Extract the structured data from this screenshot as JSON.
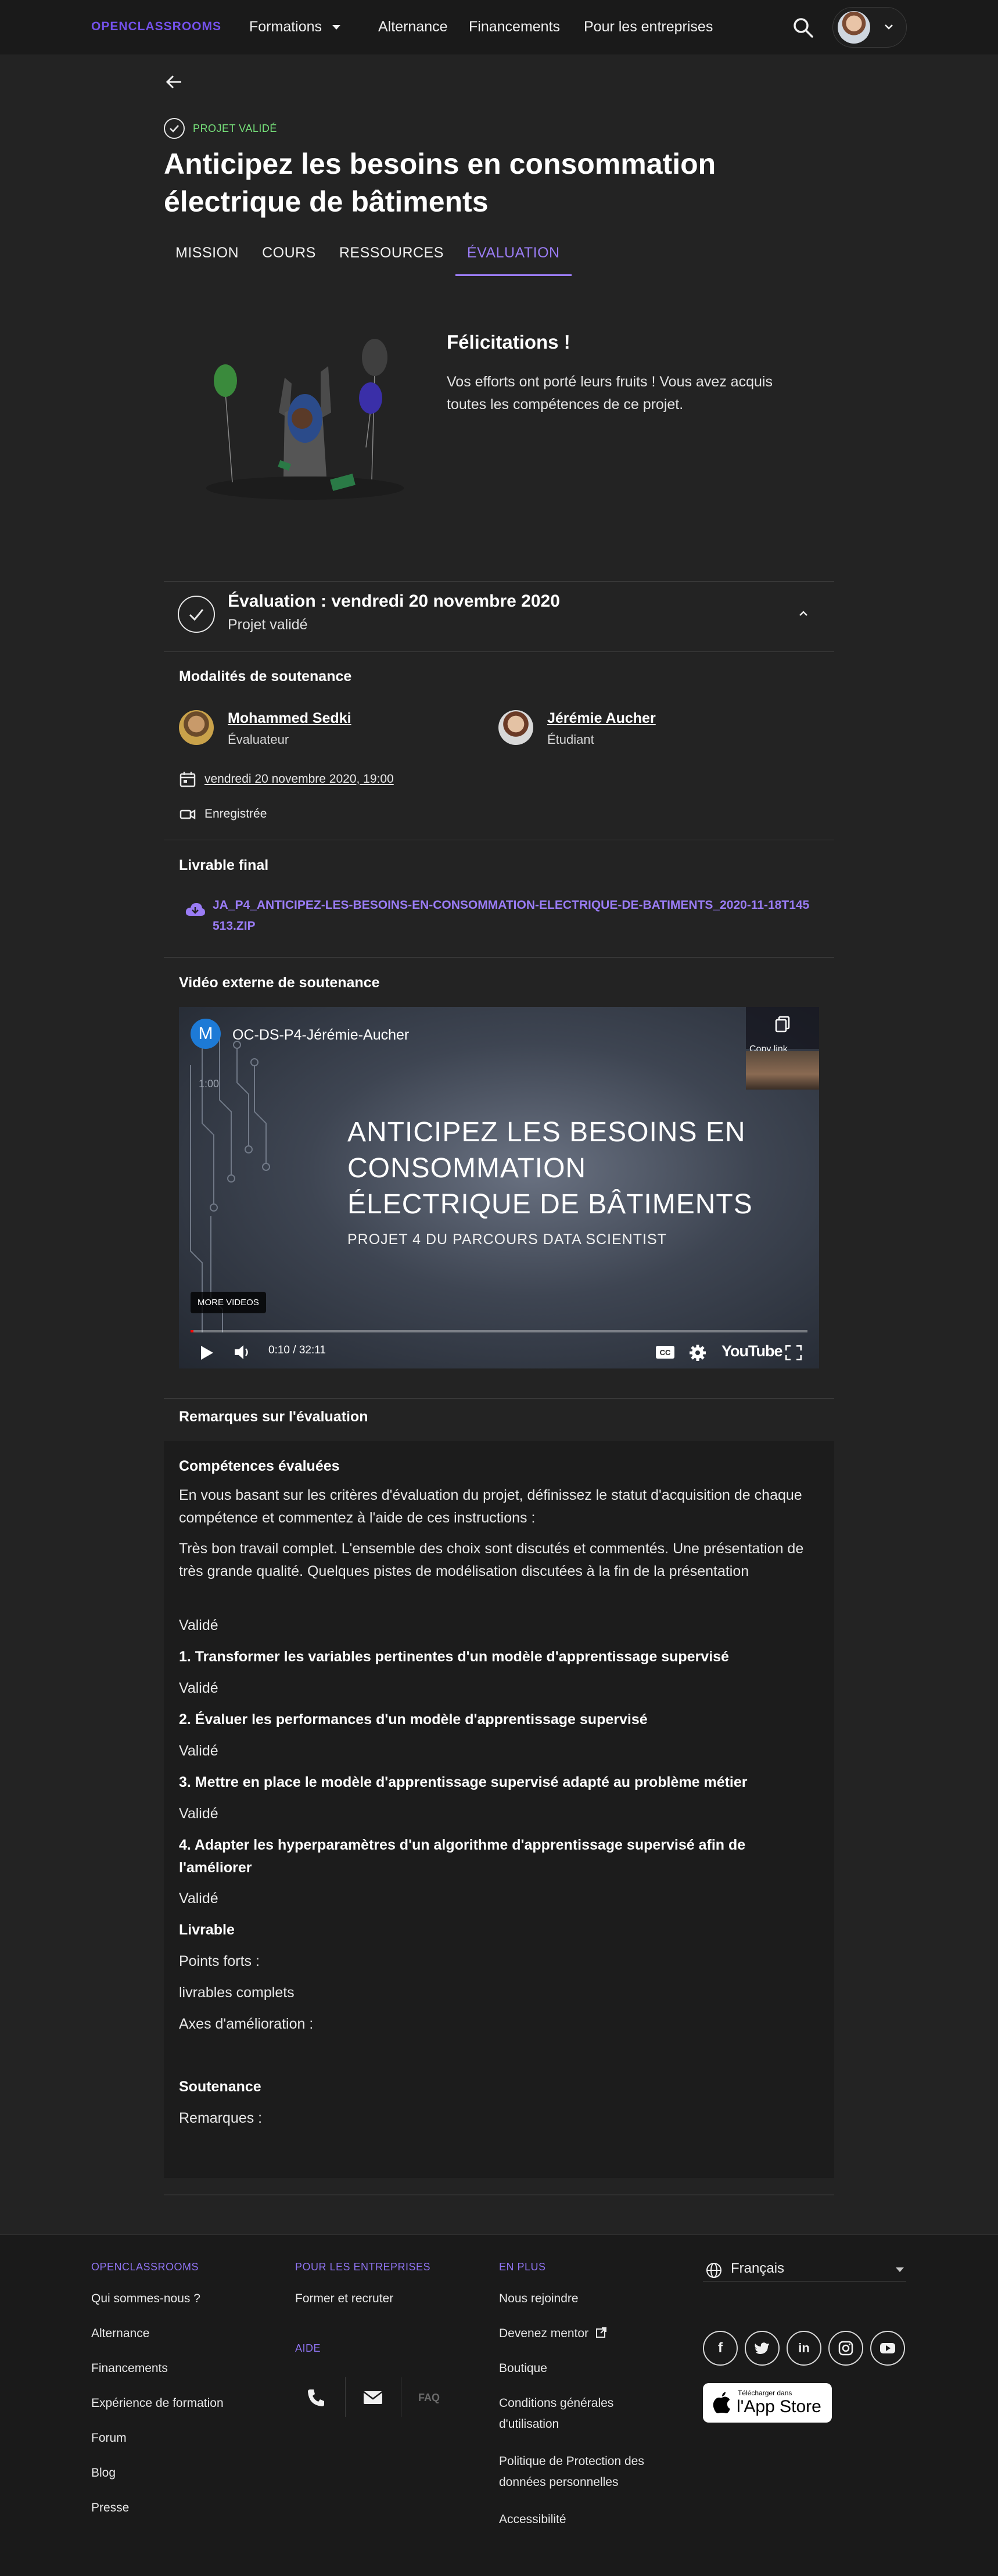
{
  "header": {
    "logo": "OPENCLASSROOMS",
    "nav": [
      "Formations",
      "Alternance",
      "Financements",
      "Pour les entreprises"
    ]
  },
  "project": {
    "status": "PROJET VALIDÉ",
    "title": "Anticipez les besoins en consommation électrique de bâtiments",
    "tabs": [
      "MISSION",
      "COURS",
      "RESSOURCES",
      "ÉVALUATION"
    ],
    "active_tab": "ÉVALUATION"
  },
  "congrats": {
    "title": "Félicitations !",
    "text": "Vos efforts ont porté leurs fruits ! Vous avez acquis toutes les compétences de ce projet."
  },
  "evaluation": {
    "title": "Évaluation : vendredi 20 novembre 2020",
    "subtitle": "Projet validé",
    "modalities_title": "Modalités de soutenance",
    "evaluator": {
      "name": "Mohammed Sedki",
      "role": "Évaluateur"
    },
    "student": {
      "name": "Jérémie Aucher",
      "role": "Étudiant"
    },
    "date": "vendredi 20 novembre 2020, 19:00",
    "recorded": "Enregistrée",
    "deliverable_title": "Livrable final",
    "deliverable_file": "JA_P4_ANTICIPEZ-LES-BESOINS-EN-CONSOMMATION-ELECTRIQUE-DE-BATIMENTS_2020-11-18T145513.ZIP",
    "video_title": "Vidéo externe de soutenance",
    "video": {
      "channel_initial": "M",
      "channel_name": "OC-DS-P4-Jérémie-Aucher",
      "small_time": "1:00",
      "copy_link": "Copy link",
      "slide_title": "ANTICIPEZ LES BESOINS EN CONSOMMATION ÉLECTRIQUE DE BÂTIMENTS",
      "slide_subtitle": "PROJET 4 DU PARCOURS DATA SCIENTIST",
      "more_videos": "MORE VIDEOS",
      "time": "0:10 / 32:11",
      "youtube": "YouTube",
      "progress_fraction": 0.005
    },
    "remarks_title": "Remarques sur l'évaluation",
    "remarks": {
      "skills_title": "Compétences évaluées",
      "instructions": "En vous basant sur les critères d'évaluation du projet, définissez le statut d'acquisition de chaque compétence et commentez à l'aide de ces instructions :",
      "comment": "Très bon travail complet. L'ensemble des choix sont discutés et commentés. Une présentation de très grande qualité.  Quelques pistes de modélisation discutées à la fin de la présentation",
      "status_0": "Validé",
      "skill_1": "1. Transformer les variables pertinentes d'un modèle d'apprentissage supervisé",
      "status_1": "Validé",
      "skill_2": "2. Évaluer les performances d'un modèle d'apprentissage supervisé",
      "status_2": "Validé",
      "skill_3": "3. Mettre en place le modèle d'apprentissage supervisé adapté au problème métier",
      "status_3": "Validé",
      "skill_4": "4. Adapter les hyperparamètres d'un algorithme d'apprentissage supervisé afin de l'améliorer",
      "status_4": "Validé",
      "livrable_title": "Livrable",
      "strengths_label": "Points forts :",
      "strengths": "livrables complets",
      "improve_label": "Axes d'amélioration :",
      "soutenance_title": "Soutenance",
      "remarks_label": "Remarques :"
    }
  },
  "footer": {
    "col1_title": "OPENCLASSROOMS",
    "col1": [
      "Qui sommes-nous ?",
      "Alternance",
      "Financements",
      "Expérience de formation",
      "Forum",
      "Blog",
      "Presse"
    ],
    "col2_title": "POUR LES ENTREPRISES",
    "col2": [
      "Former et recruter"
    ],
    "aide_title": "AIDE",
    "faq": "FAQ",
    "col3_title": "EN PLUS",
    "col3": [
      "Nous rejoindre",
      "Devenez mentor",
      "Boutique",
      "Conditions générales d'utilisation",
      "Politique de Protection des données personnelles",
      "Accessibilité"
    ],
    "language": "Français",
    "social": [
      "facebook",
      "twitter",
      "linkedin",
      "instagram",
      "youtube"
    ],
    "appstore_small": "Télécharger dans",
    "appstore_big": "l'App Store"
  },
  "colors": {
    "accent": "#9a7cf5",
    "valid_green": "#76e07a",
    "background": "#232323"
  }
}
